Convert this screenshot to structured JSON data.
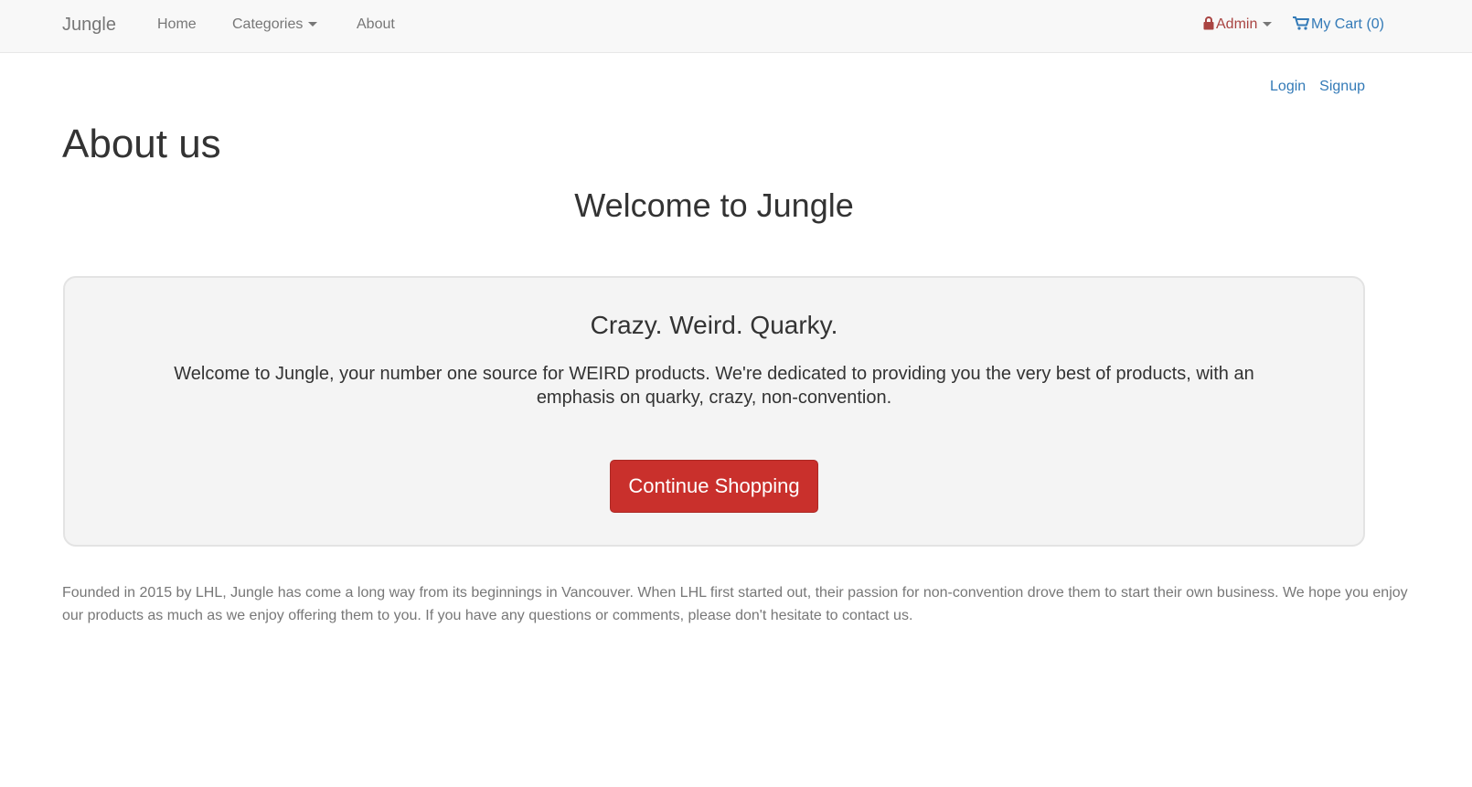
{
  "navbar": {
    "brand": "Jungle",
    "home": "Home",
    "categories": "Categories",
    "about": "About",
    "admin": "Admin",
    "cart": "My Cart (0)",
    "admin_color": "#a94442",
    "link_color": "#337ab7",
    "admin_icon": "lock-icon",
    "cart_icon": "shopping-cart-icon"
  },
  "auth": {
    "login": "Login",
    "signup": "Signup"
  },
  "page": {
    "title": "About us",
    "welcome": "Welcome to Jungle"
  },
  "jumbotron": {
    "heading": "Crazy. Weird. Quarky.",
    "text": "Welcome to Jungle, your number one source for WEIRD products. We're dedicated to providing you the very best of products, with an emphasis on quarky, crazy, non-convention.",
    "button": "Continue Shopping",
    "button_color": "#c9302c"
  },
  "footer": {
    "text": "Founded in 2015 by LHL, Jungle has come a long way from its beginnings in Vancouver. When LHL first started out, their passion for non-convention drove them to start their own business. We hope you enjoy our products as much as we enjoy offering them to you. If you have any questions or comments, please don't hesitate to contact us."
  }
}
